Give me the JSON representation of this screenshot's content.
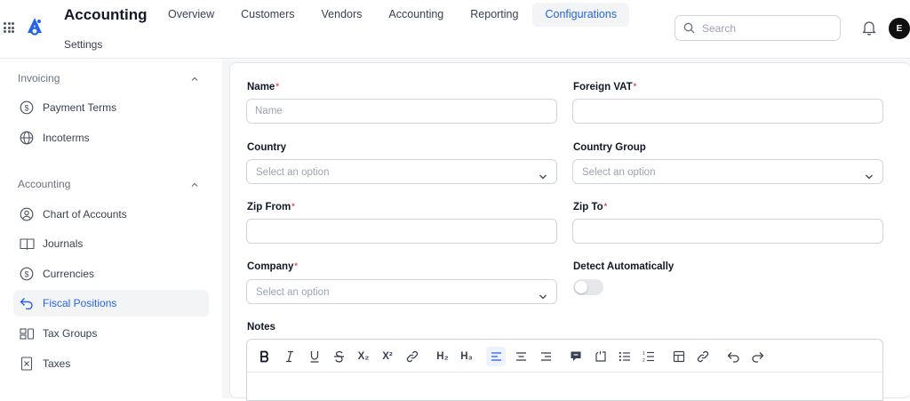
{
  "header": {
    "app_title": "Accounting",
    "breadcrumb": "Settings",
    "nav_tabs": [
      {
        "label": "Overview"
      },
      {
        "label": "Customers"
      },
      {
        "label": "Vendors"
      },
      {
        "label": "Accounting"
      },
      {
        "label": "Reporting"
      },
      {
        "label": "Configurations",
        "active": true
      }
    ],
    "search_placeholder": "Search",
    "avatar_initial": "E"
  },
  "sidebar": {
    "sections": [
      {
        "title": "Invoicing",
        "items": [
          {
            "label": "Payment Terms",
            "icon": "dollar-circle-icon"
          },
          {
            "label": "Incoterms",
            "icon": "globe-icon"
          }
        ]
      },
      {
        "title": "Accounting",
        "items": [
          {
            "label": "Chart of Accounts",
            "icon": "user-circle-icon"
          },
          {
            "label": "Journals",
            "icon": "book-open-icon"
          },
          {
            "label": "Currencies",
            "icon": "dollar-circle-icon"
          },
          {
            "label": "Fiscal Positions",
            "icon": "undo-arrow-icon",
            "active": true
          },
          {
            "label": "Tax Groups",
            "icon": "group-icon"
          },
          {
            "label": "Taxes",
            "icon": "tax-document-icon"
          }
        ]
      }
    ]
  },
  "form": {
    "name": {
      "label": "Name",
      "required": "*",
      "placeholder": "Name",
      "value": ""
    },
    "foreign_vat": {
      "label": "Foreign VAT",
      "required": "*",
      "value": ""
    },
    "country": {
      "label": "Country",
      "placeholder": "Select an option"
    },
    "country_group": {
      "label": "Country Group",
      "placeholder": "Select an option"
    },
    "zip_from": {
      "label": "Zip From",
      "required": "*",
      "value": ""
    },
    "zip_to": {
      "label": "Zip To",
      "required": "*",
      "value": ""
    },
    "company": {
      "label": "Company",
      "required": "*",
      "placeholder": "Select an option"
    },
    "detect_automatically": {
      "label": "Detect Automatically",
      "enabled": false
    },
    "notes": {
      "label": "Notes",
      "toolbar": {
        "subscript": "X₂",
        "superscript": "X²",
        "heading2": "H₂",
        "heading3": "H₃"
      }
    }
  }
}
